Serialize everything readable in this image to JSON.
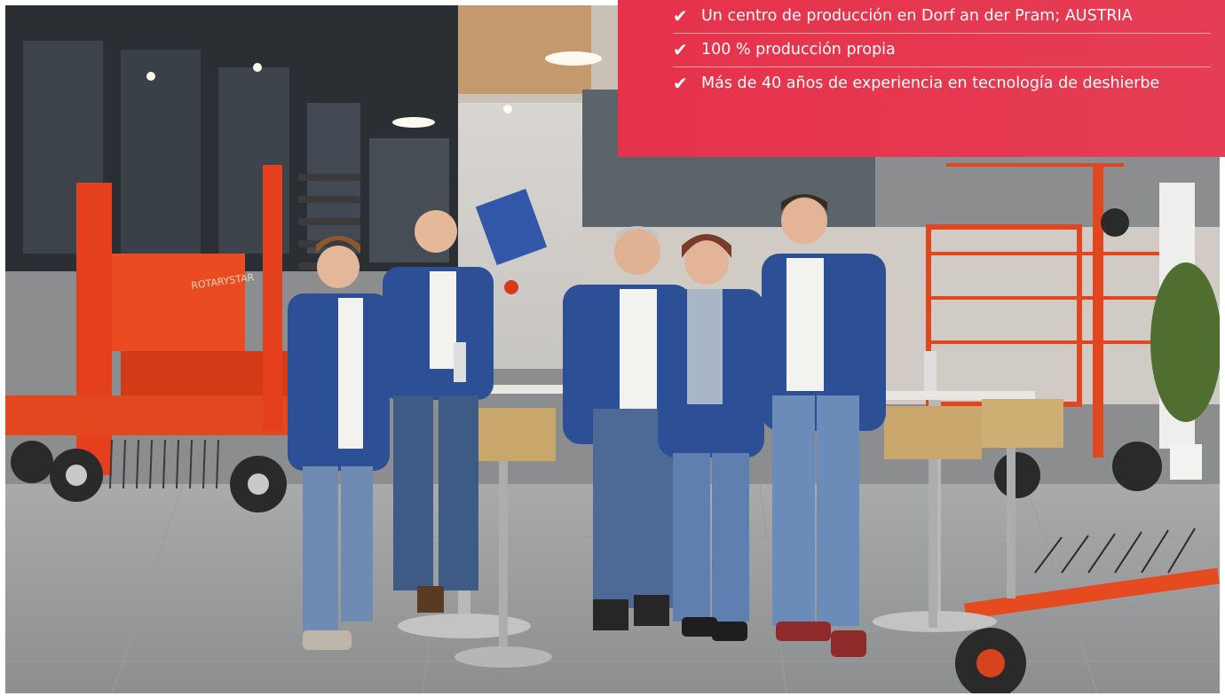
{
  "photo": {
    "subject": "Team of five people in blue jackets standing at a high table in a showroom with orange agricultural weeding machinery"
  },
  "panel": {
    "accent": "#e6324a",
    "check_icon": "checkmark-icon",
    "items": [
      {
        "label": "Un centro de producción en Dorf an der Pram; AUSTRIA"
      },
      {
        "label": "100 % producción propia"
      },
      {
        "label": "Más de 40 años de experiencia en tecnología de deshierbe"
      }
    ]
  },
  "machinery": {
    "brand_label": "ROTARYSTAR"
  }
}
